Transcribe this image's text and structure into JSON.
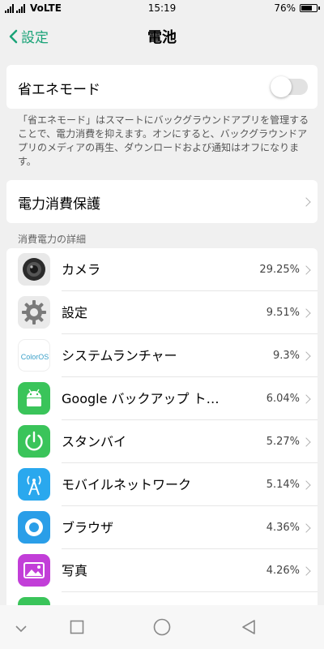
{
  "status_bar": {
    "network": "VoLTE",
    "time": "15:19",
    "battery": "76%",
    "battery_level": 0.76
  },
  "nav": {
    "back_label": "設定",
    "title": "電池"
  },
  "power_saving": {
    "label": "省エネモード",
    "enabled": false,
    "description": "「省エネモード」はスマートにバックグラウンドアプリを管理することで、電力消費を抑えます。オンにすると、バックグラウンドアプリのメディアの再生、ダウンロードおよび通知はオフになります。"
  },
  "power_protection": {
    "label": "電力消費保護"
  },
  "details": {
    "header": "消費電力の詳細",
    "apps": [
      {
        "name": "カメラ",
        "percent": "29.25%",
        "icon": "camera-icon"
      },
      {
        "name": "設定",
        "percent": "9.51%",
        "icon": "settings-gear-icon"
      },
      {
        "name": "システムランチャー",
        "percent": "9.3%",
        "icon": "coloros-logo-icon",
        "icon_text": "ColorOS"
      },
      {
        "name": "Google バックアップ ト…",
        "percent": "6.04%",
        "icon": "android-icon"
      },
      {
        "name": "スタンバイ",
        "percent": "5.27%",
        "icon": "power-icon"
      },
      {
        "name": "モバイルネットワーク",
        "percent": "5.14%",
        "icon": "antenna-icon"
      },
      {
        "name": "ブラウザ",
        "percent": "4.36%",
        "icon": "browser-icon"
      },
      {
        "name": "写真",
        "percent": "4.26%",
        "icon": "photos-icon"
      }
    ]
  },
  "colors": {
    "accent": "#1aa378",
    "background": "#f0f0f0"
  }
}
